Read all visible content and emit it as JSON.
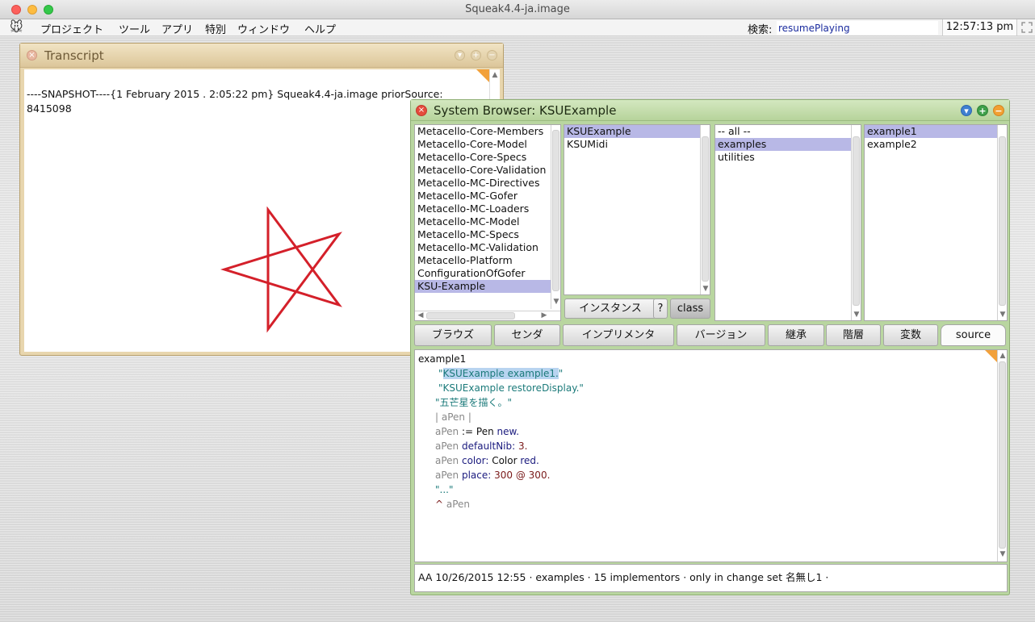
{
  "window": {
    "title": "Squeak4.4-ja.image"
  },
  "menubar": {
    "items": [
      "プロジェクト",
      "ツール",
      "アプリ",
      "特別",
      "ウィンドウ",
      "ヘルプ"
    ],
    "search_label": "検索:",
    "search_value": "resumePlaying",
    "clock": "12:57:13 pm"
  },
  "transcript": {
    "title": "Transcript",
    "line1": "----SNAPSHOT----{1 February 2015 . 2:05:22 pm} Squeak4.4-ja.image priorSource:",
    "line2": "8415098",
    "star_color": "#d4202a"
  },
  "browser": {
    "title": "System Browser: KSUExample",
    "packages": [
      "Metacello-Core-Members",
      "Metacello-Core-Model",
      "Metacello-Core-Specs",
      "Metacello-Core-Validation",
      "Metacello-MC-Directives",
      "Metacello-MC-Gofer",
      "Metacello-MC-Loaders",
      "Metacello-MC-Model",
      "Metacello-MC-Specs",
      "Metacello-MC-Validation",
      "Metacello-Platform",
      "ConfigurationOfGofer",
      "KSU-Example"
    ],
    "classes": [
      "KSUExample",
      "KSUMidi"
    ],
    "categories": [
      "-- all --",
      "examples",
      "utilities"
    ],
    "methods": [
      "example1",
      "example2"
    ],
    "instance_button": "インスタンス",
    "help_button": "?",
    "class_button": "class",
    "toolbar": [
      "ブラウズ",
      "センダ",
      "インプリメンタ",
      "バージョン",
      "継承",
      "階層",
      "変数",
      "source"
    ],
    "code": {
      "l1": "example1",
      "l2_hl": "KSUExample example1.",
      "l2_q1": "\"",
      "l2_q2": "\"",
      "l3": "\"KSUExample restoreDisplay.\"",
      "l4": "\"五芒星を描く。\"",
      "l5": "| aPen |",
      "l6_var": "aPen",
      "l6_rest": ":= Pen",
      "l6_sel": "new.",
      "l7_var": "aPen",
      "l7_sel": "defaultNib:",
      "l7_num": "3.",
      "l8_var": "aPen",
      "l8_sel": "color:",
      "l8_rest": "Color",
      "l8_sel2": "red.",
      "l9_var": "aPen",
      "l9_sel": "place:",
      "l9_num": "300 @ 300.",
      "l10": "\"...\"",
      "l11_ret": "^",
      "l11_var": "aPen"
    },
    "status": "AA 10/26/2015 12:55 · examples · 15 implementors · only in change set 名無し1 ·"
  }
}
